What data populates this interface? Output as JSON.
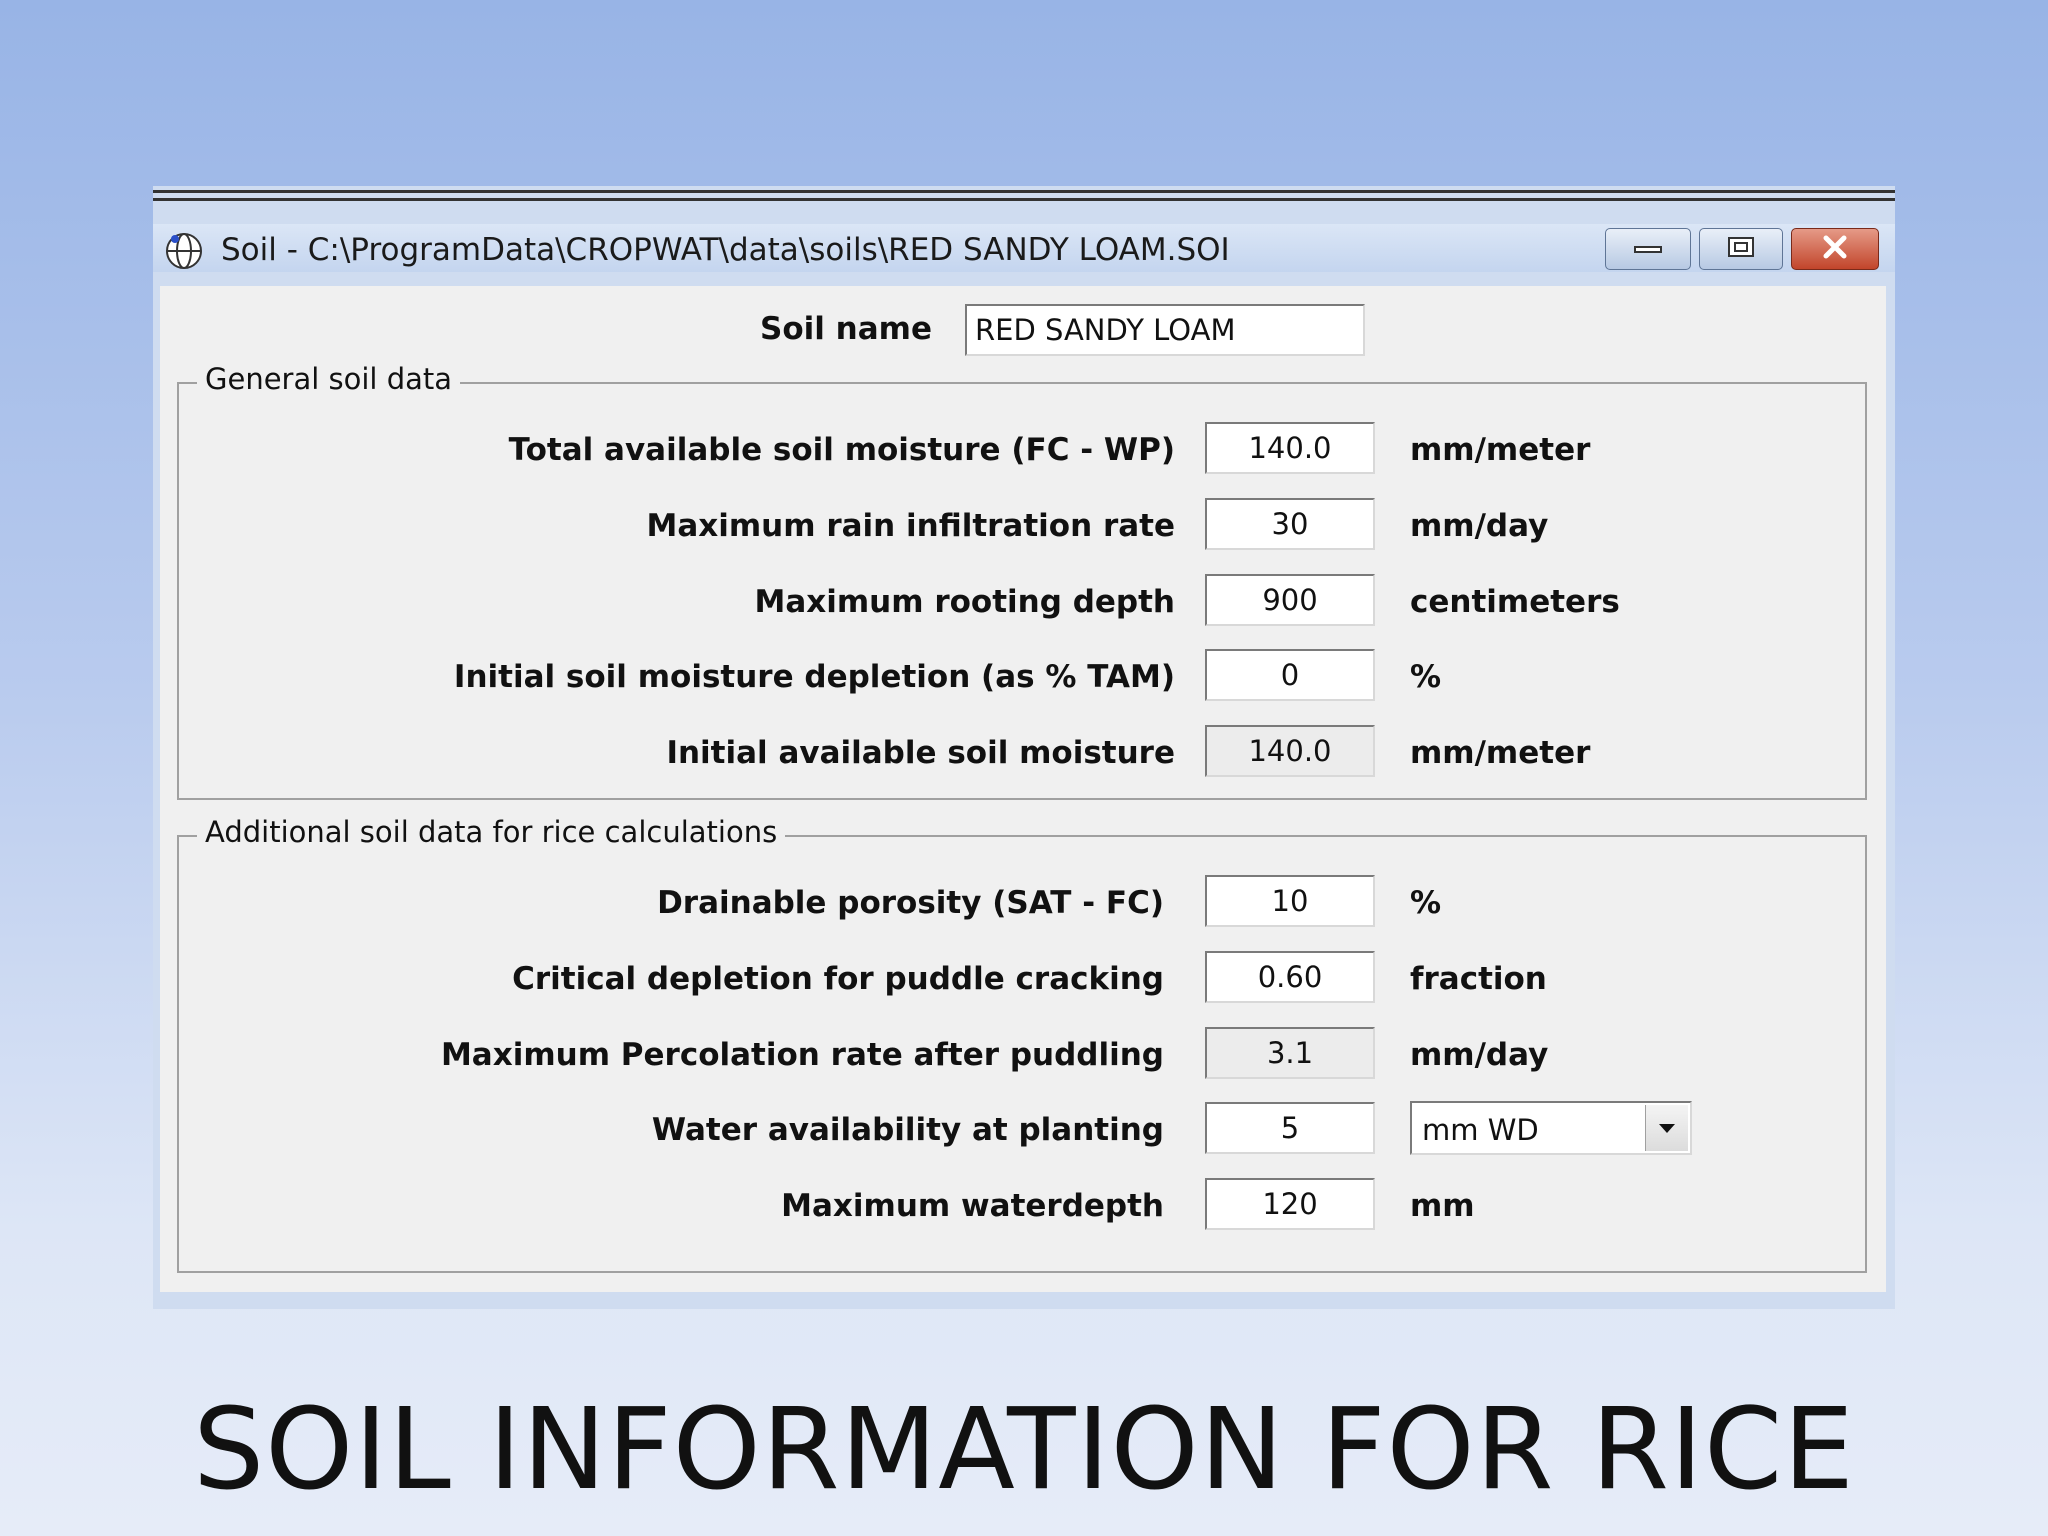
{
  "window": {
    "title": "Soil - C:\\ProgramData\\CROPWAT\\data\\soils\\RED SANDY LOAM.SOI",
    "icon": "globe-icon"
  },
  "soil_name": {
    "label": "Soil name",
    "value": "RED SANDY LOAM"
  },
  "general": {
    "legend": "General soil data",
    "rows": [
      {
        "label": "Total available soil moisture (FC - WP)",
        "value": "140.0",
        "unit": "mm/meter"
      },
      {
        "label": "Maximum rain infiltration rate",
        "value": "30",
        "unit": "mm/day"
      },
      {
        "label": "Maximum rooting depth",
        "value": "900",
        "unit": "centimeters"
      },
      {
        "label": "Initial soil moisture depletion (as % TAM)",
        "value": "0",
        "unit": "%"
      },
      {
        "label": "Initial available soil moisture",
        "value": "140.0",
        "unit": "mm/meter"
      }
    ]
  },
  "rice": {
    "legend": "Additional soil data for rice calculations",
    "rows": [
      {
        "label": "Drainable porosity (SAT - FC)",
        "value": "10",
        "unit": "%"
      },
      {
        "label": "Critical depletion for puddle cracking",
        "value": "0.60",
        "unit": "fraction"
      },
      {
        "label": "Maximum Percolation rate after puddling",
        "value": "3.1",
        "unit": "mm/day"
      },
      {
        "label": "Water availability at planting",
        "value": "5",
        "unit_select": "mm WD"
      },
      {
        "label": "Maximum waterdepth",
        "value": "120",
        "unit": "mm"
      }
    ]
  },
  "slide_title": "SOIL INFORMATION FOR RICE"
}
